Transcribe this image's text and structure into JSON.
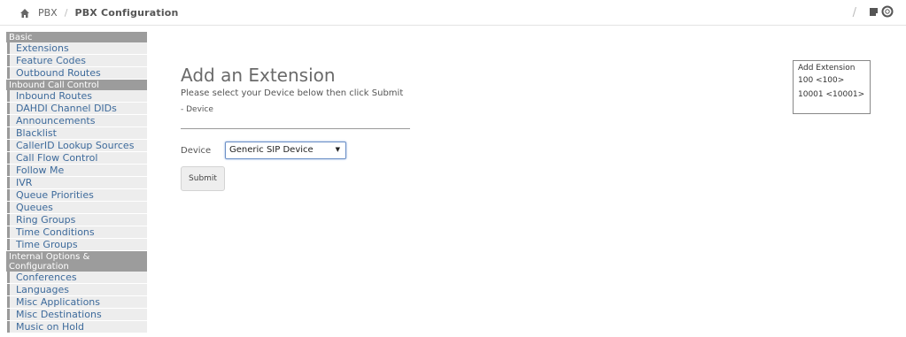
{
  "breadcrumb": {
    "home_icon": "home-icon",
    "root": "PBX",
    "separator": "/",
    "current": "PBX Configuration"
  },
  "topbar_right": {
    "separator": "/",
    "icons": [
      "notepad-icon",
      "help-lifebuoy-icon"
    ]
  },
  "sidebar": {
    "sections": [
      {
        "header": "Basic",
        "items": [
          "Extensions",
          "Feature Codes",
          "Outbound Routes"
        ]
      },
      {
        "header": "Inbound Call Control",
        "items": [
          "Inbound Routes",
          "DAHDI Channel DIDs",
          "Announcements",
          "Blacklist",
          "CallerID Lookup Sources",
          "Call Flow Control",
          "Follow Me",
          "IVR",
          "Queue Priorities",
          "Queues",
          "Ring Groups",
          "Time Conditions",
          "Time Groups"
        ]
      },
      {
        "header": "Internal Options & Configuration",
        "items": [
          "Conferences",
          "Languages",
          "Misc Applications",
          "Misc Destinations",
          "Music on Hold"
        ]
      }
    ]
  },
  "main": {
    "title": "Add an Extension",
    "subtitle": "Please select your Device below then click Submit",
    "section_label": "- Device",
    "device_label": "Device",
    "device_selected": "Generic SIP Device",
    "submit_label": "Submit"
  },
  "right_panel": {
    "title": "Add Extension",
    "items": [
      "100 <100>",
      "10001 <10001>"
    ]
  },
  "colors": {
    "link": "#3d6a9b",
    "section_header": "#9c9c9c",
    "nav_bg": "#ededed"
  }
}
